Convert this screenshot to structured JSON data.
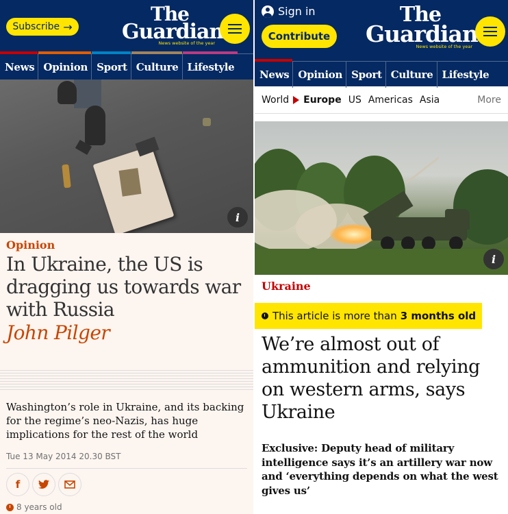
{
  "left": {
    "header": {
      "subscribe_label": "Subscribe",
      "subscribe_arrow": "→",
      "logo_line1": "The",
      "logo_line2": "Guardian",
      "logo_tag": "News website of the year"
    },
    "nav": [
      {
        "label": "News",
        "color": "#c70000"
      },
      {
        "label": "Opinion",
        "color": "#e05e00"
      },
      {
        "label": "Sport",
        "color": "#0084c6"
      },
      {
        "label": "Culture",
        "color": "#a1845c"
      },
      {
        "label": "Lifestyle",
        "color": "#bb3b80"
      }
    ],
    "image": {
      "info_label": "i"
    },
    "article": {
      "kicker": "Opinion",
      "headline": "In Ukraine, the US is dragging us towards war with Russia",
      "byline": "John Pilger",
      "standfirst": "Washington’s role in Ukraine, and its backing for the regime’s neo-Nazis, has huge implications for the rest of the world",
      "date": "Tue 13 May 2014 20.30 BST",
      "share": {
        "facebook": "f",
        "twitter": "t",
        "email": "✉"
      },
      "age": "8 years old"
    }
  },
  "right": {
    "header": {
      "signin_label": "Sign in",
      "contribute_label": "Contribute",
      "logo_line1": "The",
      "logo_line2": "Guardian",
      "logo_tag": "News website of the year"
    },
    "nav": [
      {
        "label": "News",
        "color": "#c70000"
      },
      {
        "label": "Opinion",
        "color": "#e05e00"
      },
      {
        "label": "Sport",
        "color": "#0084c6"
      },
      {
        "label": "Culture",
        "color": "#a1845c"
      },
      {
        "label": "Lifestyle",
        "color": "#bb3b80"
      }
    ],
    "subnav": {
      "items": [
        "World",
        "Europe",
        "US",
        "Americas",
        "Asia"
      ],
      "selected": "Europe",
      "more": "More"
    },
    "image": {
      "info_label": "i"
    },
    "article": {
      "kicker": "Ukraine",
      "age_banner_prefix": "This article is more than",
      "age_banner_value": "3 months old",
      "headline": "We’re almost out of ammunition and relying on western arms, says Ukraine",
      "standfirst": "Exclusive: Deputy head of military intelligence says it’s an artillery war now and ‘everything depends on what the west gives us’"
    }
  },
  "colors": {
    "brand_blue": "#052962",
    "brand_yellow": "#ffe500",
    "opinion_orange": "#c74600",
    "news_red": "#c70000"
  }
}
